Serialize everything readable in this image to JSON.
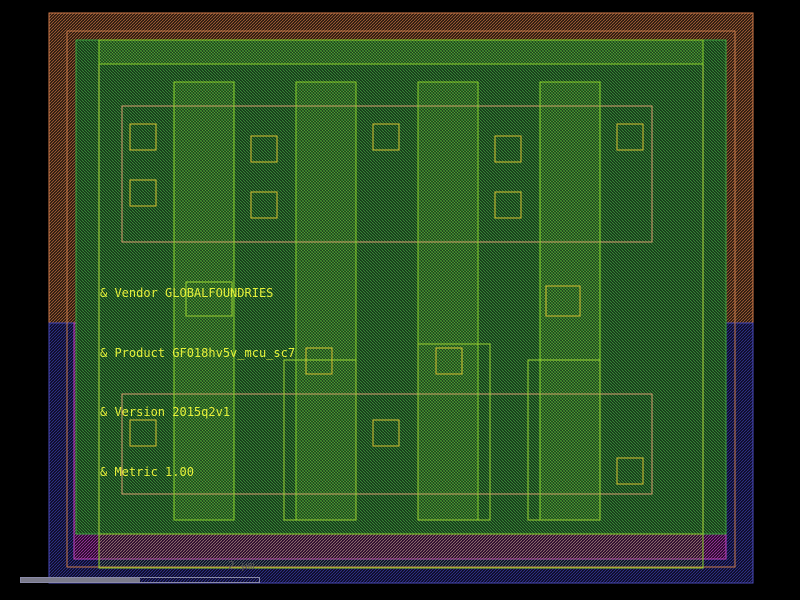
{
  "labels": [
    "& Vendor GLOBALFOUNDRIES",
    "& Product GF018hv5v_mcu_sc7",
    "& Version 2015q2v1",
    "& Metric 1.00"
  ],
  "scale_text": "2 μm",
  "scalebar_fraction": 0.5,
  "colors": {
    "background": "#000000",
    "nwell": "#c87a4a",
    "pwell": "#3a3aa8",
    "diffusion": "#3ca03c",
    "implant": "#c040c0",
    "poly": "#8ad02a",
    "contact": "#d8c030",
    "label": "#e6f03a"
  }
}
